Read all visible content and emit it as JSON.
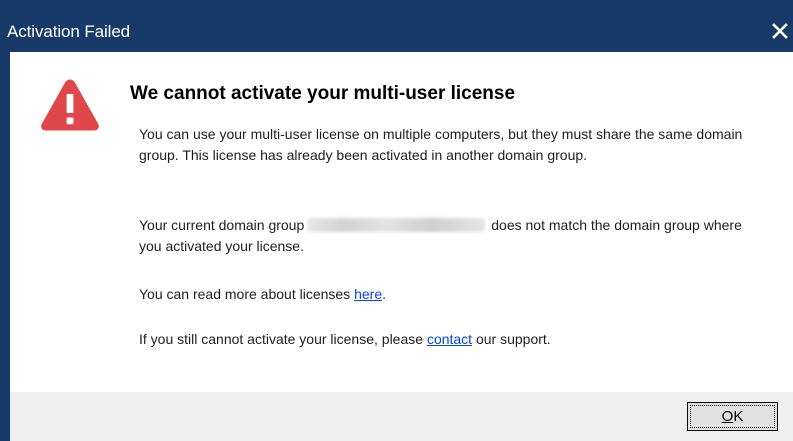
{
  "window": {
    "title": "Activation Failed",
    "close_icon": "close-icon",
    "title_bar_color": "#173a68"
  },
  "main": {
    "icon": "warning-triangle-icon",
    "icon_color": "#e0474b",
    "heading": "We cannot activate your multi-user license",
    "paragraph1": "You can use your multi-user license on multiple computers, but they must share the same domain group. This license has already been activated in another domain group.",
    "paragraph2": {
      "before": "Your current domain group",
      "after": "does not match the domain group where you activated your license."
    },
    "paragraph3": {
      "before": "You can read more about licenses ",
      "link": "here",
      "after": "."
    },
    "paragraph4": {
      "before": "If you still cannot activate your license, please ",
      "link": "contact",
      "after": " our support."
    },
    "link_color": "#0645dc"
  },
  "footer": {
    "ok_accel": "O",
    "ok_rest": "K"
  }
}
